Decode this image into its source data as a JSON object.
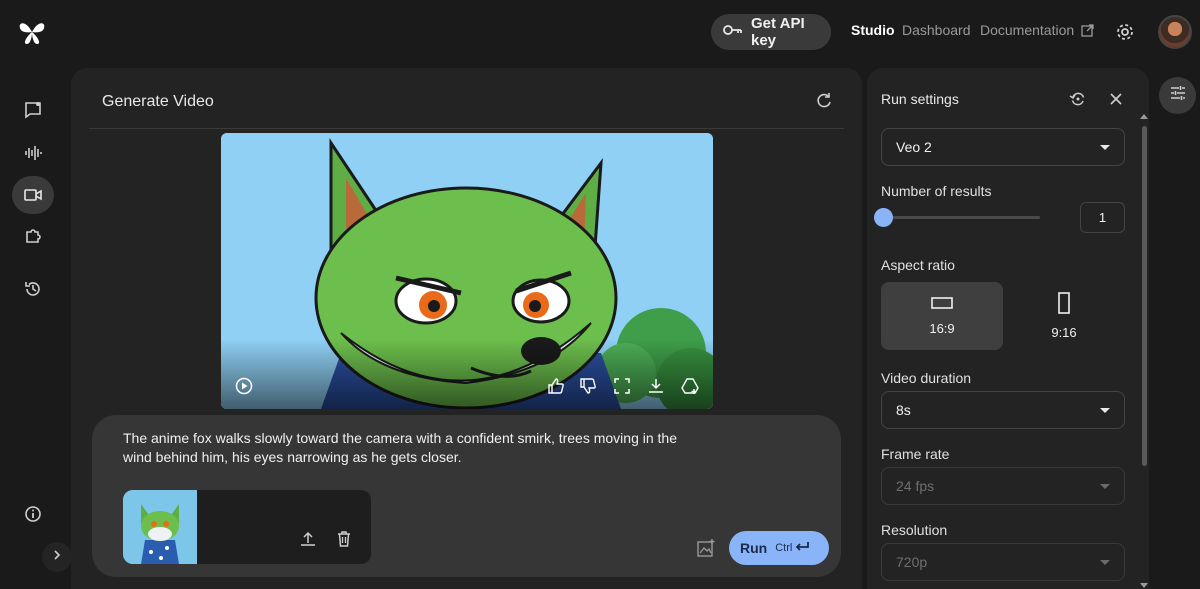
{
  "topbar": {
    "api_key_label": "Get API key",
    "nav": [
      {
        "label": "Studio"
      },
      {
        "label": "Dashboard"
      },
      {
        "label": "Documentation"
      }
    ],
    "accent": "#8ab4f8"
  },
  "rail": {
    "items": [
      "chat-icon",
      "audio-icon",
      "video-icon",
      "extensions-icon",
      "history-icon"
    ],
    "info_icon": "info-icon",
    "expand_icon": "chevron-right-icon"
  },
  "main": {
    "title": "Generate Video",
    "prompt": "The anime fox walks slowly toward the camera with a confident smirk, trees moving in the wind behind him, his eyes narrowing as he gets closer.",
    "run_label": "Run",
    "run_shortcut": "Ctrl"
  },
  "settings": {
    "title": "Run settings",
    "model": "Veo 2",
    "results_label": "Number of results",
    "results_value": "1",
    "results_slider_fraction": 0.0,
    "aspect_label": "Aspect ratio",
    "aspect_options": [
      {
        "label": "16:9",
        "selected": true
      },
      {
        "label": "9:16",
        "selected": false
      }
    ],
    "duration_label": "Video duration",
    "duration_value": "8s",
    "framerate_label": "Frame rate",
    "framerate_value": "24 fps",
    "resolution_label": "Resolution",
    "resolution_value": "720p"
  }
}
